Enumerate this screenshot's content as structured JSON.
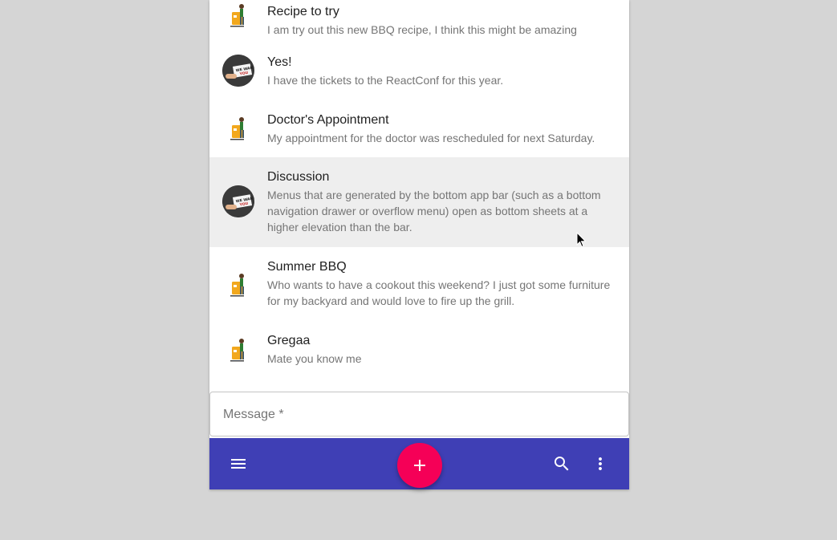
{
  "messages": [
    {
      "primary": "Recipe to try",
      "secondary": "I am try out this new BBQ recipe, I think this might be amazing",
      "avatar": "delivery-person-icon"
    },
    {
      "primary": "Yes!",
      "secondary": "I have the tickets to the ReactConf for this year.",
      "avatar": "we-want-you-icon"
    },
    {
      "primary": "Doctor's Appointment",
      "secondary": "My appointment for the doctor was rescheduled for next Saturday.",
      "avatar": "delivery-person-icon"
    },
    {
      "primary": "Discussion",
      "secondary": "Menus that are generated by the bottom app bar (such as a bottom navigation drawer or overflow menu) open as bottom sheets at a higher elevation than the bar.",
      "avatar": "we-want-you-icon"
    },
    {
      "primary": "Summer BBQ",
      "secondary": "Who wants to have a cookout this weekend? I just got some furniture for my backyard and would love to fire up the grill.",
      "avatar": "delivery-person-icon"
    },
    {
      "primary": "Gregaa",
      "secondary": "Mate you know me",
      "avatar": "delivery-person-icon"
    }
  ],
  "message_input": {
    "placeholder": "Message *",
    "value": ""
  },
  "appbar": {
    "menu_icon": "menu-icon",
    "fab_icon": "add-icon",
    "search_icon": "search-icon",
    "more_icon": "more-vert-icon"
  },
  "colors": {
    "appbar": "#3f3fb5",
    "fab": "#f50057",
    "highlight": "#eeeeee"
  }
}
